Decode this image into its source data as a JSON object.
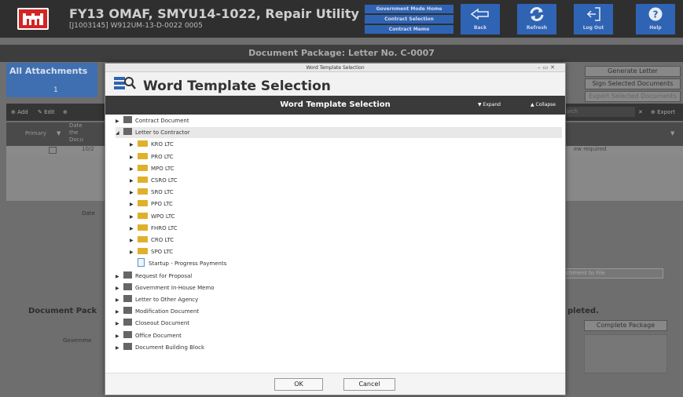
{
  "header": {
    "title": "FY13 OMAF, SMYU14-1022, Repair Utility",
    "subtitle": "[J1003145] W912UM-13-D-0022 0005",
    "menu": [
      "Government Mode Home",
      "Contract Selection",
      "Contract Memo"
    ],
    "buttons": [
      "Back",
      "Refresh",
      "Log Out",
      "Help"
    ]
  },
  "package_bar": "Document Package: Letter No. C-0007",
  "left": {
    "all_attachments": "All Attachments",
    "count": "1",
    "toolbar": [
      "Add",
      "Edit"
    ],
    "grid": {
      "primary": "Primary",
      "date_col": "Date\nthe\nDocu",
      "row_date": "10/2"
    },
    "date_label": "Date",
    "doc_pack": "Document Pack",
    "government": "Governme"
  },
  "right": {
    "buttons": [
      "Generate Letter",
      "Sign Selected Documents",
      "Export Selected Documents"
    ],
    "search_placeholder": "arch",
    "export": "Export",
    "review": "ew required",
    "attach_file": "chment to File",
    "completed": "pleted.",
    "complete_package": "Complete Package"
  },
  "dialog": {
    "titlebar": "Word Template Selection",
    "heading": "Word Template Selection",
    "bar_title": "Word Template Selection",
    "expand": "Expand",
    "collapse": "Collapse",
    "tree": [
      {
        "label": "Contract Document",
        "kind": "sq",
        "level": 0,
        "arrow": "▶"
      },
      {
        "label": "Letter to Contractor",
        "kind": "sq",
        "level": 0,
        "arrow": "◢",
        "selected": true
      },
      {
        "label": "KRO LTC",
        "kind": "fold",
        "level": 1,
        "arrow": "▶"
      },
      {
        "label": "PRO LTC",
        "kind": "fold",
        "level": 1,
        "arrow": "▶"
      },
      {
        "label": "MPO LTC",
        "kind": "fold",
        "level": 1,
        "arrow": "▶"
      },
      {
        "label": "CSRO LTC",
        "kind": "fold",
        "level": 1,
        "arrow": "▶"
      },
      {
        "label": "SRO LTC",
        "kind": "fold",
        "level": 1,
        "arrow": "▶"
      },
      {
        "label": "PPO LTC",
        "kind": "fold",
        "level": 1,
        "arrow": "▶"
      },
      {
        "label": "WPO LTC",
        "kind": "fold",
        "level": 1,
        "arrow": "▶"
      },
      {
        "label": "FHRO LTC",
        "kind": "fold",
        "level": 1,
        "arrow": "▶"
      },
      {
        "label": "CRO LTC",
        "kind": "fold",
        "level": 1,
        "arrow": "▶"
      },
      {
        "label": "SPO LTC",
        "kind": "fold",
        "level": 1,
        "arrow": "▶"
      },
      {
        "label": "Startup - Progress Payments",
        "kind": "doc",
        "level": 1,
        "arrow": ""
      },
      {
        "label": "Request for Proposal",
        "kind": "sq",
        "level": 0,
        "arrow": "▶"
      },
      {
        "label": "Government In-House Memo",
        "kind": "sq",
        "level": 0,
        "arrow": "▶"
      },
      {
        "label": "Letter to Other Agency",
        "kind": "sq",
        "level": 0,
        "arrow": "▶"
      },
      {
        "label": "Modification Document",
        "kind": "sq",
        "level": 0,
        "arrow": "▶"
      },
      {
        "label": "Closeout Document",
        "kind": "sq",
        "level": 0,
        "arrow": "▶"
      },
      {
        "label": "Office Document",
        "kind": "sq",
        "level": 0,
        "arrow": "▶"
      },
      {
        "label": "Document Building Block",
        "kind": "sq",
        "level": 0,
        "arrow": "▶"
      }
    ],
    "ok": "OK",
    "cancel": "Cancel"
  }
}
